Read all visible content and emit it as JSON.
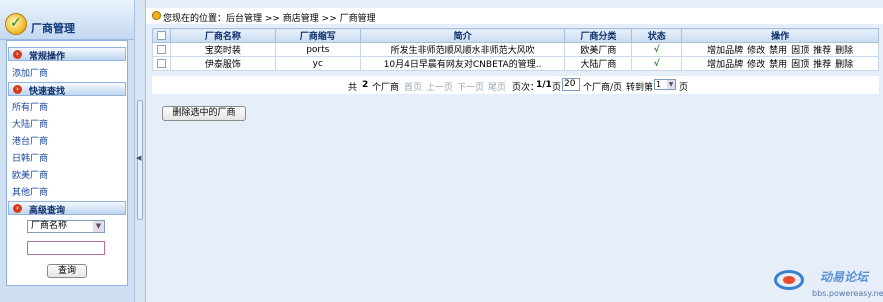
{
  "sidebar": {
    "title": "厂商管理",
    "sections": [
      {
        "label": "常规操作",
        "links": [
          "添加厂商"
        ]
      },
      {
        "label": "快速查找",
        "links": [
          "所有厂商",
          "大陆厂商",
          "港台厂商",
          "日韩厂商",
          "欧美厂商",
          "其他厂商"
        ]
      },
      {
        "label": "高级查询"
      }
    ],
    "search": {
      "field_select": "厂商名称",
      "keyword": "",
      "button": "查询"
    }
  },
  "breadcrumb": "您现在的位置：后台管理 >> 商店管理 >> 厂商管理",
  "table": {
    "columns": [
      "",
      "厂商名称",
      "厂商缩写",
      "简介",
      "厂商分类",
      "状态",
      "操作"
    ],
    "rows": [
      {
        "name": "宝奕时装",
        "abbr": "ports",
        "intro": "所发生非师范顺风顺水非师范大风吹",
        "category": "欧美厂商",
        "status": "√",
        "ops": [
          "增加品牌",
          "修改",
          "禁用",
          "固顶",
          "推荐",
          "删除"
        ]
      },
      {
        "name": "伊泰服饰",
        "abbr": "yc",
        "intro": "10月4日早晨有网友对CNBETA的管理..",
        "category": "大陆厂商",
        "status": "√",
        "ops": [
          "增加品牌",
          "修改",
          "禁用",
          "固顶",
          "推荐",
          "删除"
        ]
      }
    ]
  },
  "pager": {
    "total_prefix": "共",
    "total": "2",
    "total_suffix": "个厂商",
    "first": "首页",
    "prev": "上一页",
    "next": "下一页",
    "last": "尾页",
    "page_label": "页次：",
    "page": "1/1",
    "page_suffix": "页",
    "per_page": "20",
    "per_page_suffix": "个厂商/页",
    "goto_label": "转到第",
    "goto_value": "1",
    "goto_suffix": "页"
  },
  "delete_button": "删除选中的厂商",
  "watermark": {
    "title": "动易论坛",
    "url": "bbs.powereasy.net"
  }
}
